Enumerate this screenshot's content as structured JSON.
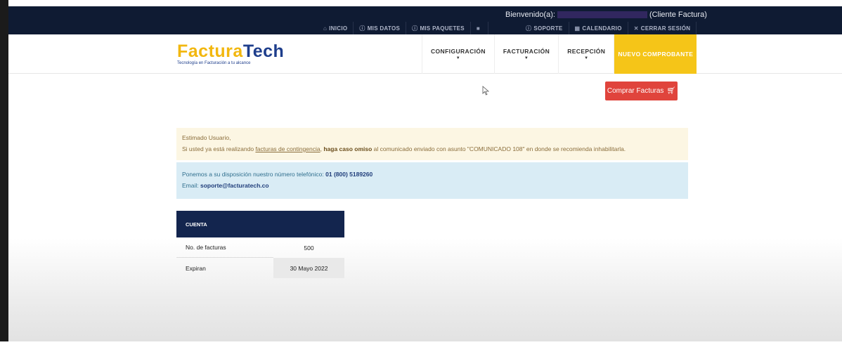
{
  "topbar": {
    "welcome_prefix": "Bienvenido(a):",
    "welcome_suffix": "(Cliente Factura)",
    "nav_left": [
      {
        "icon": "home-icon",
        "glyph": "⌂",
        "label": "INICIO"
      },
      {
        "icon": "info-icon",
        "glyph": "ⓘ",
        "label": "MIS DATOS"
      },
      {
        "icon": "info-icon",
        "glyph": "ⓘ",
        "label": "MIS PAQUETES"
      },
      {
        "icon": "video-icon",
        "glyph": "■",
        "label": ""
      }
    ],
    "nav_right": [
      {
        "icon": "support-icon",
        "glyph": "ⓘ",
        "label": "SOPORTE"
      },
      {
        "icon": "calendar-icon",
        "glyph": "▦",
        "label": "CALENDARIO"
      },
      {
        "icon": "close-icon",
        "glyph": "✕",
        "label": "CERRAR SESIÓN"
      }
    ]
  },
  "logo": {
    "brand_a": "Factura",
    "brand_b": "Tech",
    "tagline": "Tecnología en Facturación a tu alcance"
  },
  "menu": {
    "items": [
      "CONFIGURACIÓN",
      "FACTURACIÓN",
      "RECEPCIÓN"
    ],
    "cta": "NUEVO COMPROBANTE"
  },
  "buy_button": {
    "label": "Comprar Facturas",
    "icon": "cart-icon"
  },
  "alert_warning": {
    "greeting": "Estimado Usuario,",
    "text_1": "Si usted ya está realizando ",
    "link": "facturas de contingencia",
    "text_2": ", ",
    "bold": "haga caso omiso",
    "text_3": " al comunicado enviado con asunto \"COMUNICADO 108\" en donde se recomienda inhabilitarla."
  },
  "alert_info": {
    "phone_prefix": "Ponemos a su disposición nuestro número telefónico: ",
    "phone": "01 (800) 5189260",
    "email_prefix": "Email: ",
    "email": "soporte@facturatech.co"
  },
  "account": {
    "header": "CUENTA",
    "rows": [
      {
        "label": "No. de facturas",
        "value": "500"
      },
      {
        "label": "Expiran",
        "value": "30 Mayo 2022"
      }
    ]
  },
  "colors": {
    "topbar_bg": "#0f1b33",
    "brand_yellow": "#f5c518",
    "brand_blue": "#1e3e8c",
    "buy_red": "#e0443c",
    "account_header": "#13254e"
  }
}
